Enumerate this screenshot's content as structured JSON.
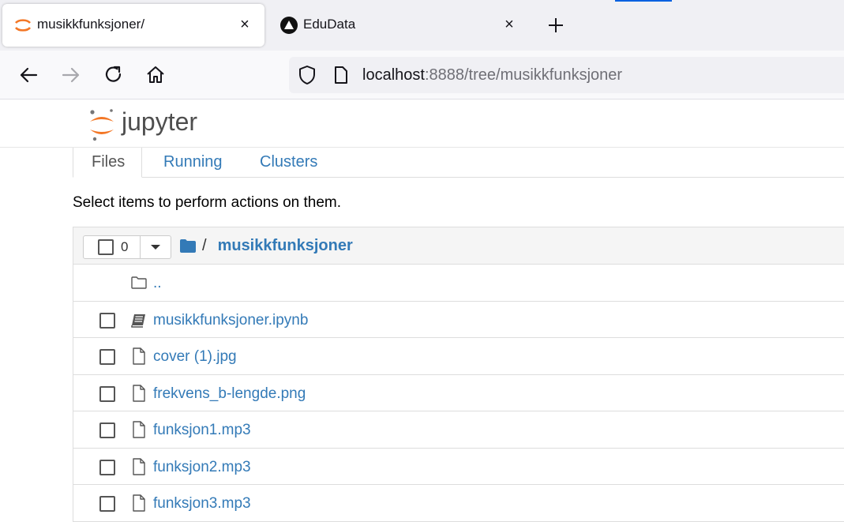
{
  "browser": {
    "tabs": [
      {
        "title": "musikkfunksjoner/",
        "active": true,
        "close": "×"
      },
      {
        "title": "EduData",
        "active": false,
        "close": "×"
      }
    ],
    "new_tab": "+",
    "url": {
      "host": "localhost",
      "rest": ":8888/tree/musikkfunksjoner"
    }
  },
  "jupyter": {
    "logo_text": "jupyter",
    "tabs": [
      {
        "label": "Files",
        "active": true
      },
      {
        "label": "Running",
        "active": false
      },
      {
        "label": "Clusters",
        "active": false
      }
    ],
    "hint": "Select items to perform actions on them.",
    "list": {
      "selected_count": "0",
      "breadcrumb_sep": "/",
      "breadcrumb_current": "musikkfunksjoner",
      "parent_link": "..",
      "items": [
        {
          "name": "musikkfunksjoner.ipynb",
          "icon": "notebook-icon"
        },
        {
          "name": "cover (1).jpg",
          "icon": "file-icon"
        },
        {
          "name": "frekvens_b-lengde.png",
          "icon": "file-icon"
        },
        {
          "name": "funksjon1.mp3",
          "icon": "file-icon"
        },
        {
          "name": "funksjon2.mp3",
          "icon": "file-icon"
        },
        {
          "name": "funksjon3.mp3",
          "icon": "file-icon"
        }
      ]
    }
  },
  "colors": {
    "link": "#337ab7",
    "jupyter_orange": "#f37726",
    "accent": "#0061e0"
  }
}
